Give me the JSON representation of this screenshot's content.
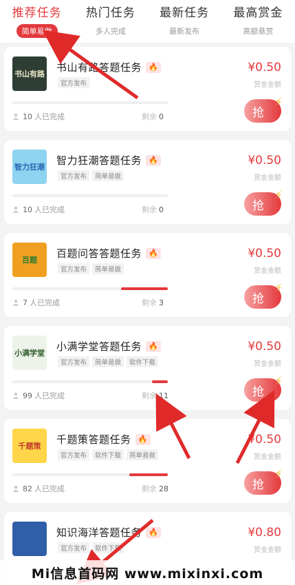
{
  "tabs": [
    {
      "title": "推荐任务",
      "sub": "简单易做"
    },
    {
      "title": "热门任务",
      "sub": "多人完成"
    },
    {
      "title": "最新任务",
      "sub": "最新发布"
    },
    {
      "title": "最高赏金",
      "sub": "高额悬赏"
    }
  ],
  "tasks": [
    {
      "title": "书山有路答题任务",
      "tags": [
        "官方发布"
      ],
      "reward": "¥0.50",
      "reward_label": "赏金金额",
      "done": "10",
      "done_label": "人已完成",
      "remain_label": "剩余",
      "remain": "0",
      "progress": 0,
      "thumb_text": "书山有路"
    },
    {
      "title": "智力狂潮答题任务",
      "tags": [
        "官方发布",
        "简单易做"
      ],
      "reward": "¥0.50",
      "reward_label": "赏金金额",
      "done": "10",
      "done_label": "人已完成",
      "remain_label": "剩余",
      "remain": "0",
      "progress": 0,
      "thumb_text": "智力狂潮"
    },
    {
      "title": "百题问答答题任务",
      "tags": [
        "官方发布",
        "简单易做"
      ],
      "reward": "¥0.50",
      "reward_label": "赏金金额",
      "done": "7",
      "done_label": "人已完成",
      "remain_label": "剩余",
      "remain": "3",
      "progress": 0.3,
      "thumb_text": "百题"
    },
    {
      "title": "小满学堂答题任务",
      "tags": [
        "官方发布",
        "简单易做",
        "软件下载"
      ],
      "reward": "¥0.50",
      "reward_label": "赏金金额",
      "done": "99",
      "done_label": "人已完成",
      "remain_label": "剩余",
      "remain": "11",
      "progress": 0.1,
      "thumb_text": "小满学堂"
    },
    {
      "title": "千题策答题任务",
      "tags": [
        "官方发布",
        "软件下载",
        "简单易做"
      ],
      "reward": "¥0.50",
      "reward_label": "赏金金额",
      "done": "82",
      "done_label": "人已完成",
      "remain_label": "剩余",
      "remain": "28",
      "progress": 0.25,
      "thumb_text": "千题策"
    },
    {
      "title": "知识海洋答题任务",
      "tags": [
        "官方发布",
        "软件下载"
      ],
      "reward": "¥0.80",
      "reward_label": "赏金金额",
      "done": "",
      "done_label": "",
      "remain_label": "",
      "remain": "",
      "progress": 0,
      "thumb_text": ""
    }
  ],
  "grab_label": "抢",
  "watermark": "Mi信息首码网 www.mixinxi.com",
  "colors": {
    "accent": "#e4393c",
    "bolt": "#f7c531"
  },
  "icons": {
    "fire": "fire-icon",
    "person": "person-icon",
    "bolt": "lightning-icon"
  }
}
